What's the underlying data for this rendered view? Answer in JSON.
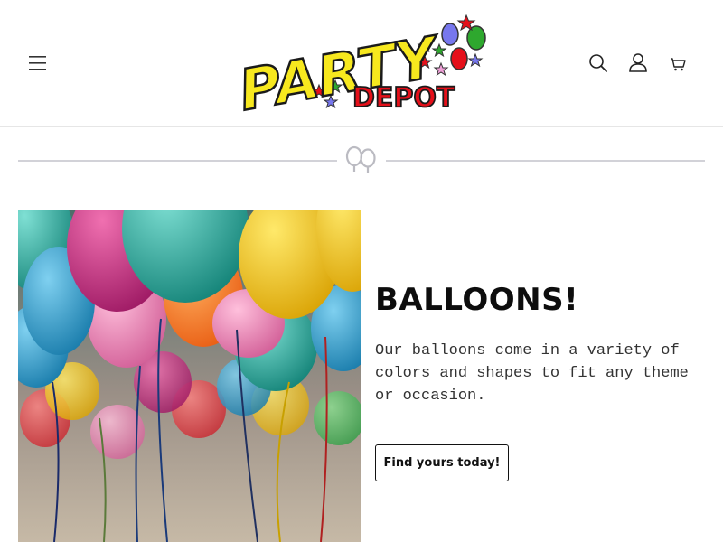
{
  "header": {
    "menu_icon": "hamburger-menu-icon",
    "logo": {
      "line1": "PARTY",
      "line2": "DEPOT"
    },
    "icons": [
      "search-icon",
      "account-icon",
      "cart-icon"
    ]
  },
  "divider": {
    "icon": "balloon-pair-icon"
  },
  "hero": {
    "title": "BALLOONS!",
    "text": "Our balloons come in a variety of colors and shapes to fit any theme or occasion.",
    "button_label": "Find yours today!"
  },
  "colors": {
    "logo_yellow": "#f7e81e",
    "logo_red": "#e5101a",
    "header_border": "#e6e6e6",
    "divider_line": "#d2d2d8",
    "text_dark": "#121212"
  }
}
